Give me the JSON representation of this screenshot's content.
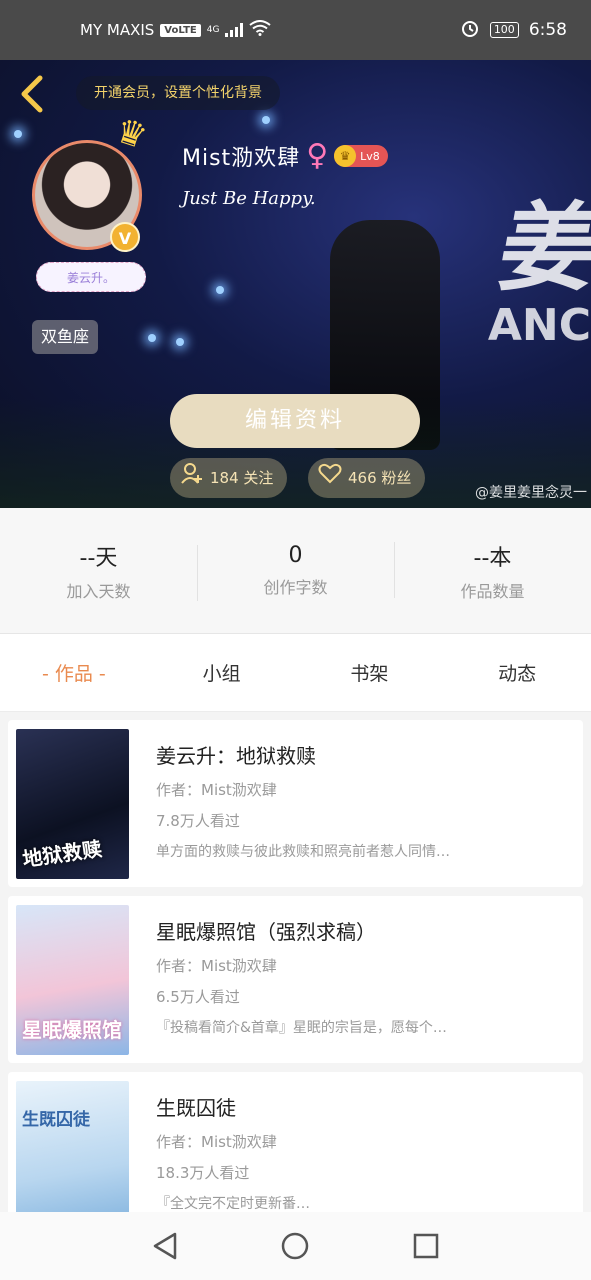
{
  "status_bar": {
    "carrier": "MY MAXIS",
    "volte": "VoLTE",
    "network": "4G",
    "battery": "100",
    "time": "6:58"
  },
  "header": {
    "vip_banner": "开通会员，设置个性化背景",
    "user_name": "Mist泐欢肆",
    "level": "Lv8",
    "bio": "Just Be Happy.",
    "nick_tag": "姜云升。",
    "zodiac": "双鱼座",
    "edit_button": "编辑资料",
    "following": "184 关注",
    "fans": "466 粉丝",
    "watermark": "@姜里姜里念灵一",
    "stage_sign": "姜",
    "stage_sign2": "ANC"
  },
  "stats": [
    {
      "value": "--天",
      "label": "加入天数"
    },
    {
      "value": "0",
      "label": "创作字数"
    },
    {
      "value": "--本",
      "label": "作品数量"
    }
  ],
  "tabs": [
    "- 作品 -",
    "小组",
    "书架",
    "动态"
  ],
  "books": [
    {
      "title": "姜云升：地狱救赎",
      "author": "作者：Mist泐欢肆",
      "views": "7.8万人看过",
      "desc": "单方面的救赎与彼此救赎和照亮前者惹人同情…",
      "cover_text": "地狱救赎"
    },
    {
      "title": "星眠爆照馆（强烈求稿）",
      "author": "作者：Mist泐欢肆",
      "views": "6.5万人看过",
      "desc": "『投稿看简介&首章』星眠的宗旨是，愿每个…",
      "cover_text": "星眠爆照馆"
    },
    {
      "title": "生既囚徒",
      "author": "作者：Mist泐欢肆",
      "views": "18.3万人看过",
      "desc": "『全文完不定时更新番…",
      "cover_text": "生既囚徒"
    }
  ],
  "colors": {
    "accent": "#e98a4f",
    "vip_gold": "#f3d36b",
    "edit_button": "#e8dcc0",
    "level_badge": "#e45555"
  }
}
